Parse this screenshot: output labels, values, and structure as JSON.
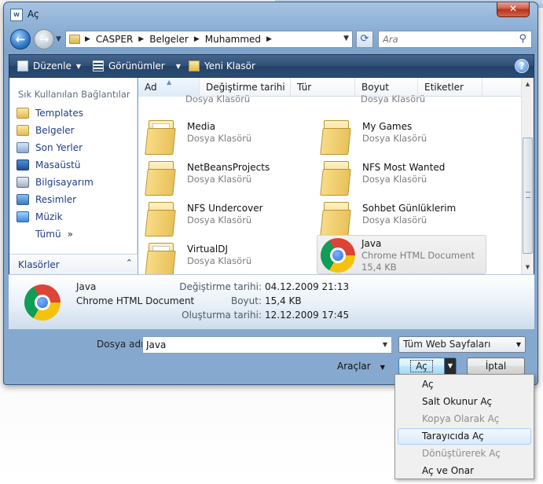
{
  "window": {
    "title": "Aç",
    "app_icon_text": "W"
  },
  "nav": {
    "breadcrumbs": [
      "CASPER",
      "Belgeler",
      "Muhammed"
    ],
    "search_placeholder": "Ara"
  },
  "toolbar": {
    "organize": "Düzenle",
    "views": "Görünümler",
    "new_folder": "Yeni Klasör",
    "help": "?"
  },
  "sidebar": {
    "header": "Sık Kullanılan Bağlantılar",
    "items": [
      {
        "label": "Templates",
        "icon": "templates-folder-icon"
      },
      {
        "label": "Belgeler",
        "icon": "documents-folder-icon"
      },
      {
        "label": "Son Yerler",
        "icon": "recent-places-icon"
      },
      {
        "label": "Masaüstü",
        "icon": "desktop-icon"
      },
      {
        "label": "Bilgisayarım",
        "icon": "computer-icon"
      },
      {
        "label": "Resimler",
        "icon": "pictures-icon"
      },
      {
        "label": "Müzik",
        "icon": "music-icon"
      }
    ],
    "more": "Tümü",
    "folders": "Klasörler"
  },
  "columns": [
    "Ad",
    "Değiştirme tarihi",
    "Tür",
    "Boyut",
    "Etiketler"
  ],
  "partial_row": {
    "left": "Dosya Klasörü",
    "right": "Dosya Klasörü"
  },
  "files": [
    {
      "name": "Media",
      "type": "Dosya Klasörü"
    },
    {
      "name": "My Games",
      "type": "Dosya Klasörü"
    },
    {
      "name": "NetBeansProjects",
      "type": "Dosya Klasörü"
    },
    {
      "name": "NFS Most Wanted",
      "type": "Dosya Klasörü"
    },
    {
      "name": "NFS Undercover",
      "type": "Dosya Klasörü"
    },
    {
      "name": "Sohbet Günlüklerim",
      "type": "Dosya Klasörü"
    },
    {
      "name": "VirtualDJ",
      "type": "Dosya Klasörü"
    },
    {
      "name": "Java",
      "type": "Chrome HTML Document",
      "size": "15,4 KB",
      "selected": true
    }
  ],
  "details": {
    "name": "Java",
    "type": "Chrome HTML Document",
    "modified_label": "Değiştirme tarihi:",
    "modified": "04.12.2009 21:13",
    "size_label": "Boyut:",
    "size": "15,4 KB",
    "created_label": "Oluşturma tarihi:",
    "created": "12.12.2009 17:45"
  },
  "bottom": {
    "filename_label": "Dosya adı:",
    "filename": "Java",
    "filter": "Tüm Web Sayfaları",
    "tools": "Araçlar",
    "open": "Aç",
    "cancel": "İptal"
  },
  "open_menu": [
    {
      "label": "Aç",
      "enabled": true
    },
    {
      "label": "Salt Okunur Aç",
      "enabled": true
    },
    {
      "label": "Kopya Olarak Aç",
      "enabled": false
    },
    {
      "label": "Tarayıcıda Aç",
      "enabled": true,
      "highlighted": true
    },
    {
      "label": "Dönüştürerek Aç",
      "enabled": false
    },
    {
      "label": "Aç ve Onar",
      "enabled": true
    }
  ]
}
